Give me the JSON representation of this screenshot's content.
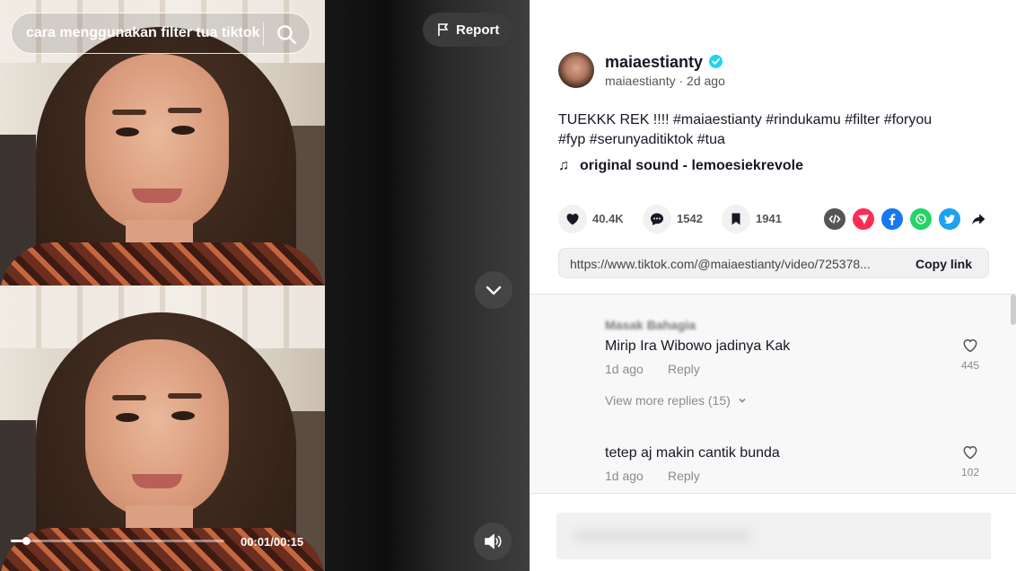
{
  "search": {
    "query": "cara menggunakan filter tua tiktok"
  },
  "video": {
    "time": "00:01/00:15",
    "progress": 0.07
  },
  "report": {
    "label": "Report"
  },
  "author": {
    "username": "maiaestianty",
    "handle": "maiaestianty",
    "posted": "2d ago",
    "separator": " · "
  },
  "caption": {
    "line1": "TUEKKK REK !!!! #maiaestianty #rindukamu #filter #foryou",
    "line2": "#fyp #serunyaditiktok #tua"
  },
  "sound": {
    "icon": "♫",
    "label": "original sound - lemoesiekrevole"
  },
  "actions": {
    "likes": "40.4K",
    "comments": "1542",
    "saves": "1941"
  },
  "share_icons": [
    "embed-icon",
    "send-icon",
    "facebook-icon",
    "whatsapp-icon",
    "twitter-icon",
    "share-arrow-icon"
  ],
  "link": {
    "url": "https://www.tiktok.com/@maiaestianty/video/725378...",
    "copy_label": "Copy link"
  },
  "comments": [
    {
      "blurred_name": "Masak Bahagia",
      "text": "Mirip Ira Wibowo jadinya Kak",
      "time": "1d ago",
      "reply": "Reply",
      "likes": "445"
    },
    {
      "text": "tetep aj makin cantik bunda",
      "time": "1d ago",
      "reply": "Reply",
      "likes": "102"
    }
  ],
  "view_more": "View more replies (15)",
  "colors": {
    "verified": "#20d5ec",
    "share_red": "#fe2c55",
    "facebook": "#1877f2",
    "whatsapp": "#25d366",
    "twitter": "#1da1f2"
  }
}
